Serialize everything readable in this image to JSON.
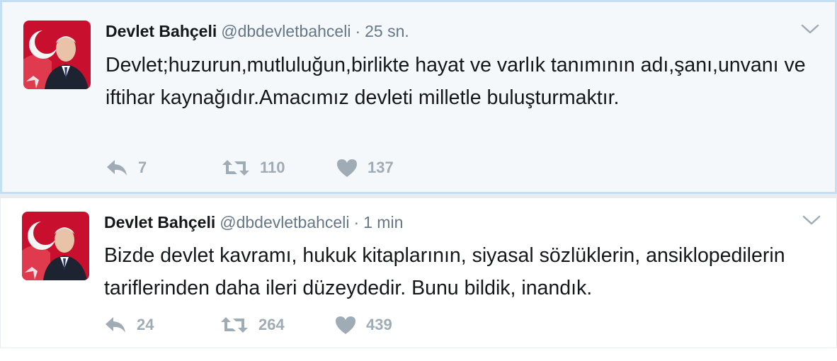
{
  "colors": {
    "name": "#14171a",
    "meta": "#657786",
    "action": "#a0acb5",
    "highlight_bg": "#f5f8fa",
    "highlight_border": "#c3dff1"
  },
  "icons": {
    "reply": "reply-arrow-icon",
    "retweet": "retweet-arrows-icon",
    "like": "heart-icon",
    "menu": "chevron-down-icon"
  },
  "tweets": [
    {
      "name": "Devlet Bahçeli",
      "handle": "@dbdevletbahceli",
      "separator": "·",
      "time": "25 sn.",
      "text": "Devlet;huzurun,mutluluğun,birlikte hayat ve varlık tanımının adı,şanı,unvanı ve iftihar kaynağıdır.Amacımız devleti milletle buluşturmaktır.",
      "replies": "7",
      "retweets": "110",
      "likes": "137"
    },
    {
      "name": "Devlet Bahçeli",
      "handle": "@dbdevletbahceli",
      "separator": "·",
      "time": "1 min",
      "text": "Bizde devlet kavramı, hukuk kitaplarının, siyasal sözlüklerin, ansiklopedilerin tariflerinden daha ileri düzeydedir. Bunu bildik, inandık.",
      "replies": "24",
      "retweets": "264",
      "likes": "439"
    }
  ]
}
